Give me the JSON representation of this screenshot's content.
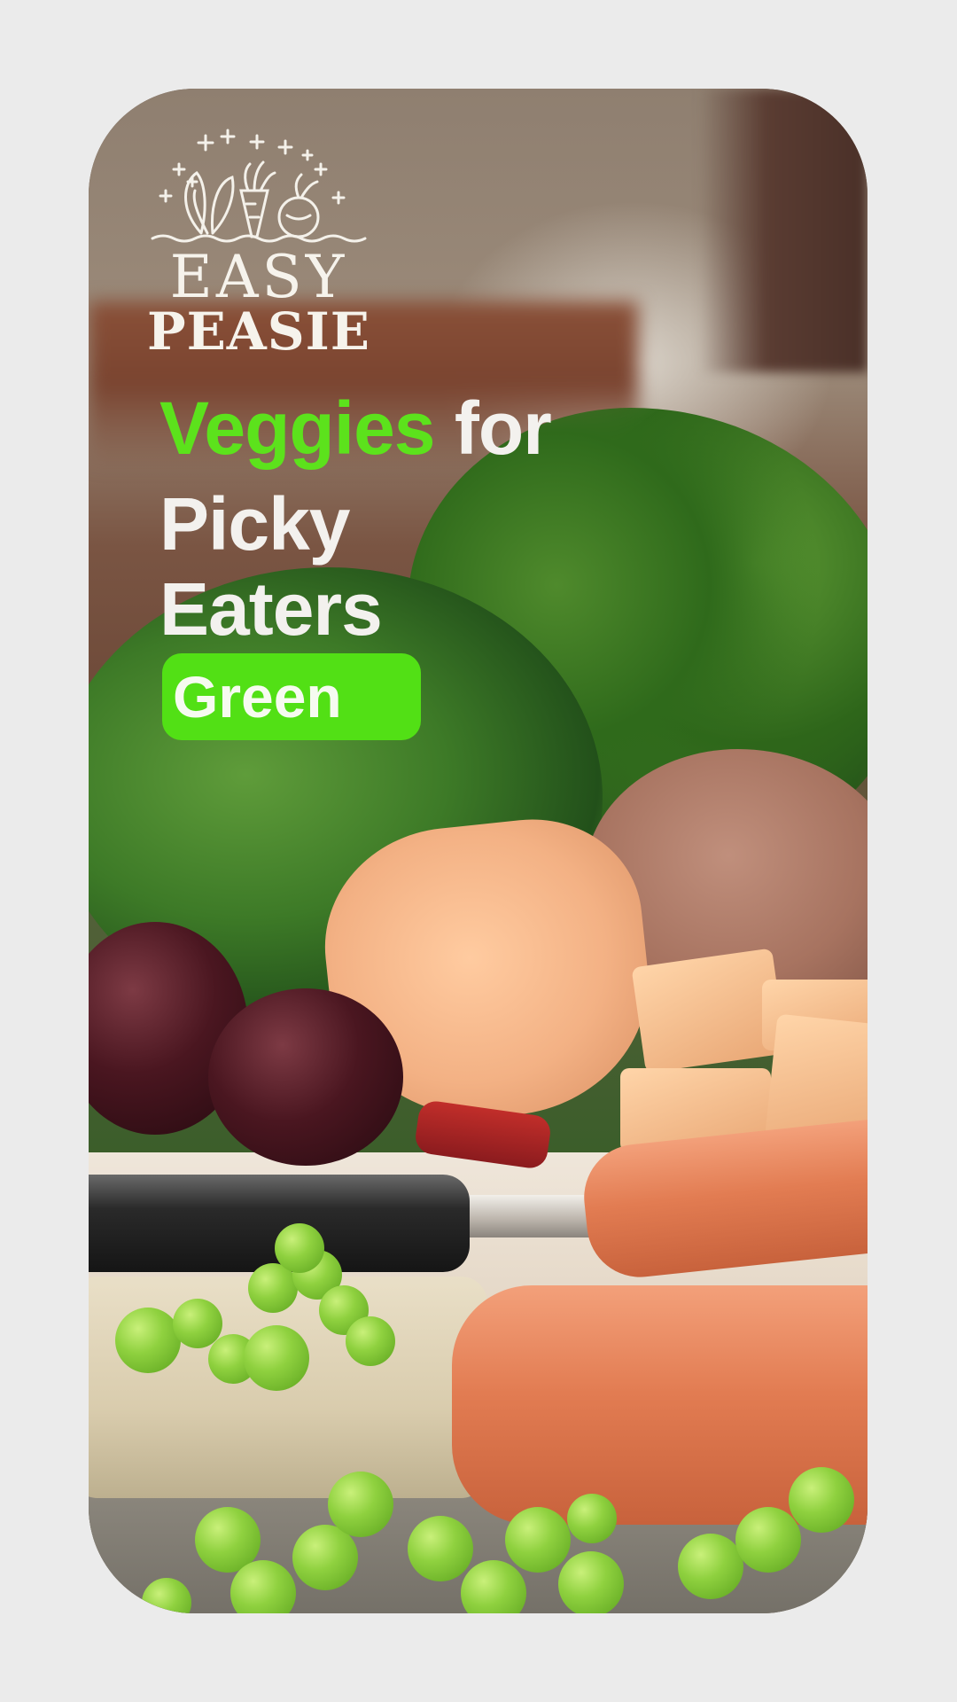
{
  "logo": {
    "line1": "EASY",
    "line2": "PEASIE"
  },
  "headline": {
    "word_accent": "Veggies",
    "word_rest": "for",
    "line2": "Picky",
    "line3": "Eaters"
  },
  "tag": {
    "label": "Green"
  },
  "colors": {
    "accent": "#5ce21c",
    "tag_bg": "#52e015",
    "headline_text": "#f3f1ee",
    "page_bg": "#ebebeb"
  },
  "icons": [
    "sparkle-icon",
    "leaf-icon",
    "carrot-icon",
    "beet-icon"
  ]
}
